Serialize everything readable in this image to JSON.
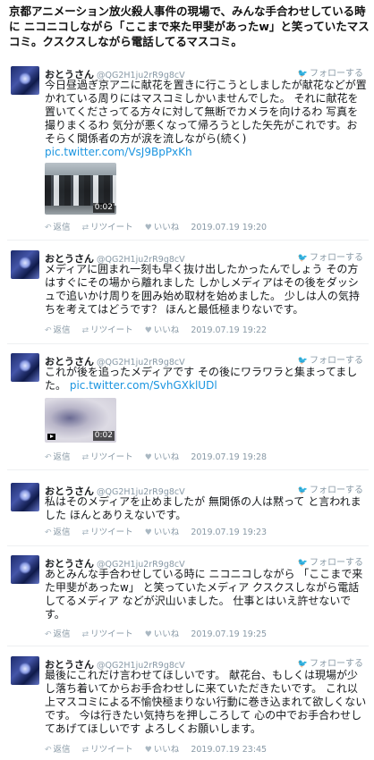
{
  "headline": "京都アニメーション放火殺人事件の現場で、みんな手合わせしている時に ニコニコしながら「ここまで来た甲斐があったw」と笑っていたマスコミ。クスクスしながら電話してるマスコミ。",
  "labels": {
    "follow": "フォローする",
    "reply": "返信",
    "retweet": "リツイート",
    "like": "いいね"
  },
  "icons": {
    "bird": "twitter-bird-icon",
    "reply": "reply-arrow-icon",
    "retweet": "retweet-icon",
    "like": "heart-icon"
  },
  "colors": {
    "link": "#1b95e0",
    "muted": "#8899a6"
  },
  "tweets": [
    {
      "name": "おとうさん",
      "handle": "@QG2H1ju2rR9g8cV",
      "text": "今日昼過ぎ京アニに献花を置きに行こうとしましたが献花などが置かれている周りにはマスコミしかいませんでした。 それに献花を置いてくださってる方々に対して無断でカメラを向けるわ 写真を撮りまくるわ 気分が悪くなって帰ろうとした矢先がこれです。おそらく関係者の方が涙を流しながら(続く)",
      "link": "pic.twitter.com/VsJ9BpPxKh",
      "media_duration": "0:02",
      "timestamp": "2019.07.19 19:20"
    },
    {
      "name": "おとうさん",
      "handle": "@QG2H1ju2rR9g8cV",
      "text": "メディアに囲まれ一刻も早く抜け出したかったんでしょう その方はすぐにその場から離れました しかしメディアはその後をダッシュで追いかけ周りを囲み始め取材を始めました。 少しは人の気持ちを考えてはどうです？ ほんと最低極まりないです。",
      "timestamp": "2019.07.19 19:22"
    },
    {
      "name": "おとうさん",
      "handle": "@QG2H1ju2rR9g8cV",
      "text": "これが後を追ったメディアです その後にワラワラと集まってました。",
      "link": "pic.twitter.com/SvhGXklUDl",
      "media_duration": "0:02",
      "timestamp": "2019.07.19 19:28"
    },
    {
      "name": "おとうさん",
      "handle": "@QG2H1ju2rR9g8cV",
      "text": "私はそのメディアを止めましたが 無関係の人は黙って と言われました ほんとありえないです。",
      "timestamp": "2019.07.19 19:23"
    },
    {
      "name": "おとうさん",
      "handle": "@QG2H1ju2rR9g8cV",
      "text": "あとみんな手合わせしている時に ニコニコしながら 「ここまで来た甲斐があったw」 と笑っていたメディア クスクスしながら電話してるメディア などが沢山いました。 仕事とはいえ許せないです。",
      "timestamp": "2019.07.19 19:25"
    },
    {
      "name": "おとうさん",
      "handle": "@QG2H1ju2rR9g8cV",
      "text": "最後にこれだけ言わせてほしいです。 献花台、もしくは現場が少し落ち着いてからお手合わせしに来ていただきたいです。 これ以上マスコミによる不愉快極まりない行動に巻き込まれて欲しくないです。 今は行きたい気持ちを押しころして 心の中でお手合わせしてあげてほしいです よろしくお願いします。",
      "timestamp": "2019.07.19 23:45"
    }
  ]
}
